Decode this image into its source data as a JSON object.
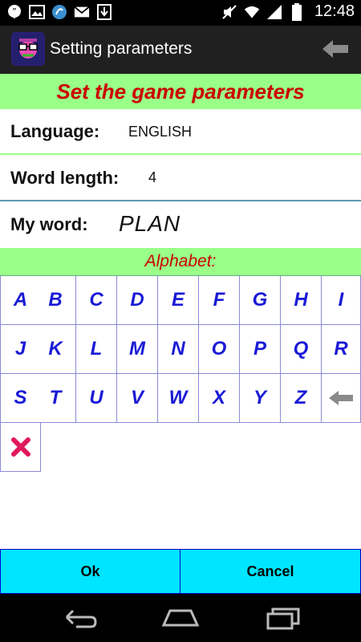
{
  "status_bar": {
    "time": "12:48",
    "icons": [
      "hangouts-icon",
      "image-icon",
      "app-icon",
      "gmail-icon",
      "download-icon",
      "mute-icon",
      "wifi-icon",
      "signal-icon",
      "battery-icon"
    ]
  },
  "action_bar": {
    "title": "Setting parameters"
  },
  "banner": {
    "text": "Set the game parameters"
  },
  "params": {
    "language_label": "Language:",
    "language_value": "ENGLISH",
    "word_length_label": "Word length:",
    "word_length_value": "4",
    "my_word_label": "My word:",
    "my_word_value": "PLAN"
  },
  "alphabet": {
    "header": "Alphabet:",
    "rows": [
      [
        "A",
        "B",
        "C",
        "D",
        "E",
        "F",
        "G",
        "H",
        "I"
      ],
      [
        "J",
        "K",
        "L",
        "M",
        "N",
        "O",
        "P",
        "Q",
        "R"
      ],
      [
        "S",
        "T",
        "U",
        "V",
        "W",
        "X",
        "Y",
        "Z"
      ]
    ],
    "backspace_icon": "backspace-arrow-icon",
    "clear_icon": "clear-x-icon"
  },
  "buttons": {
    "ok": "Ok",
    "cancel": "Cancel"
  },
  "colors": {
    "banner_bg": "#99ff88",
    "banner_text": "#cc0000",
    "letter": "#1a1ad6",
    "button_bg": "#00e5ff"
  }
}
